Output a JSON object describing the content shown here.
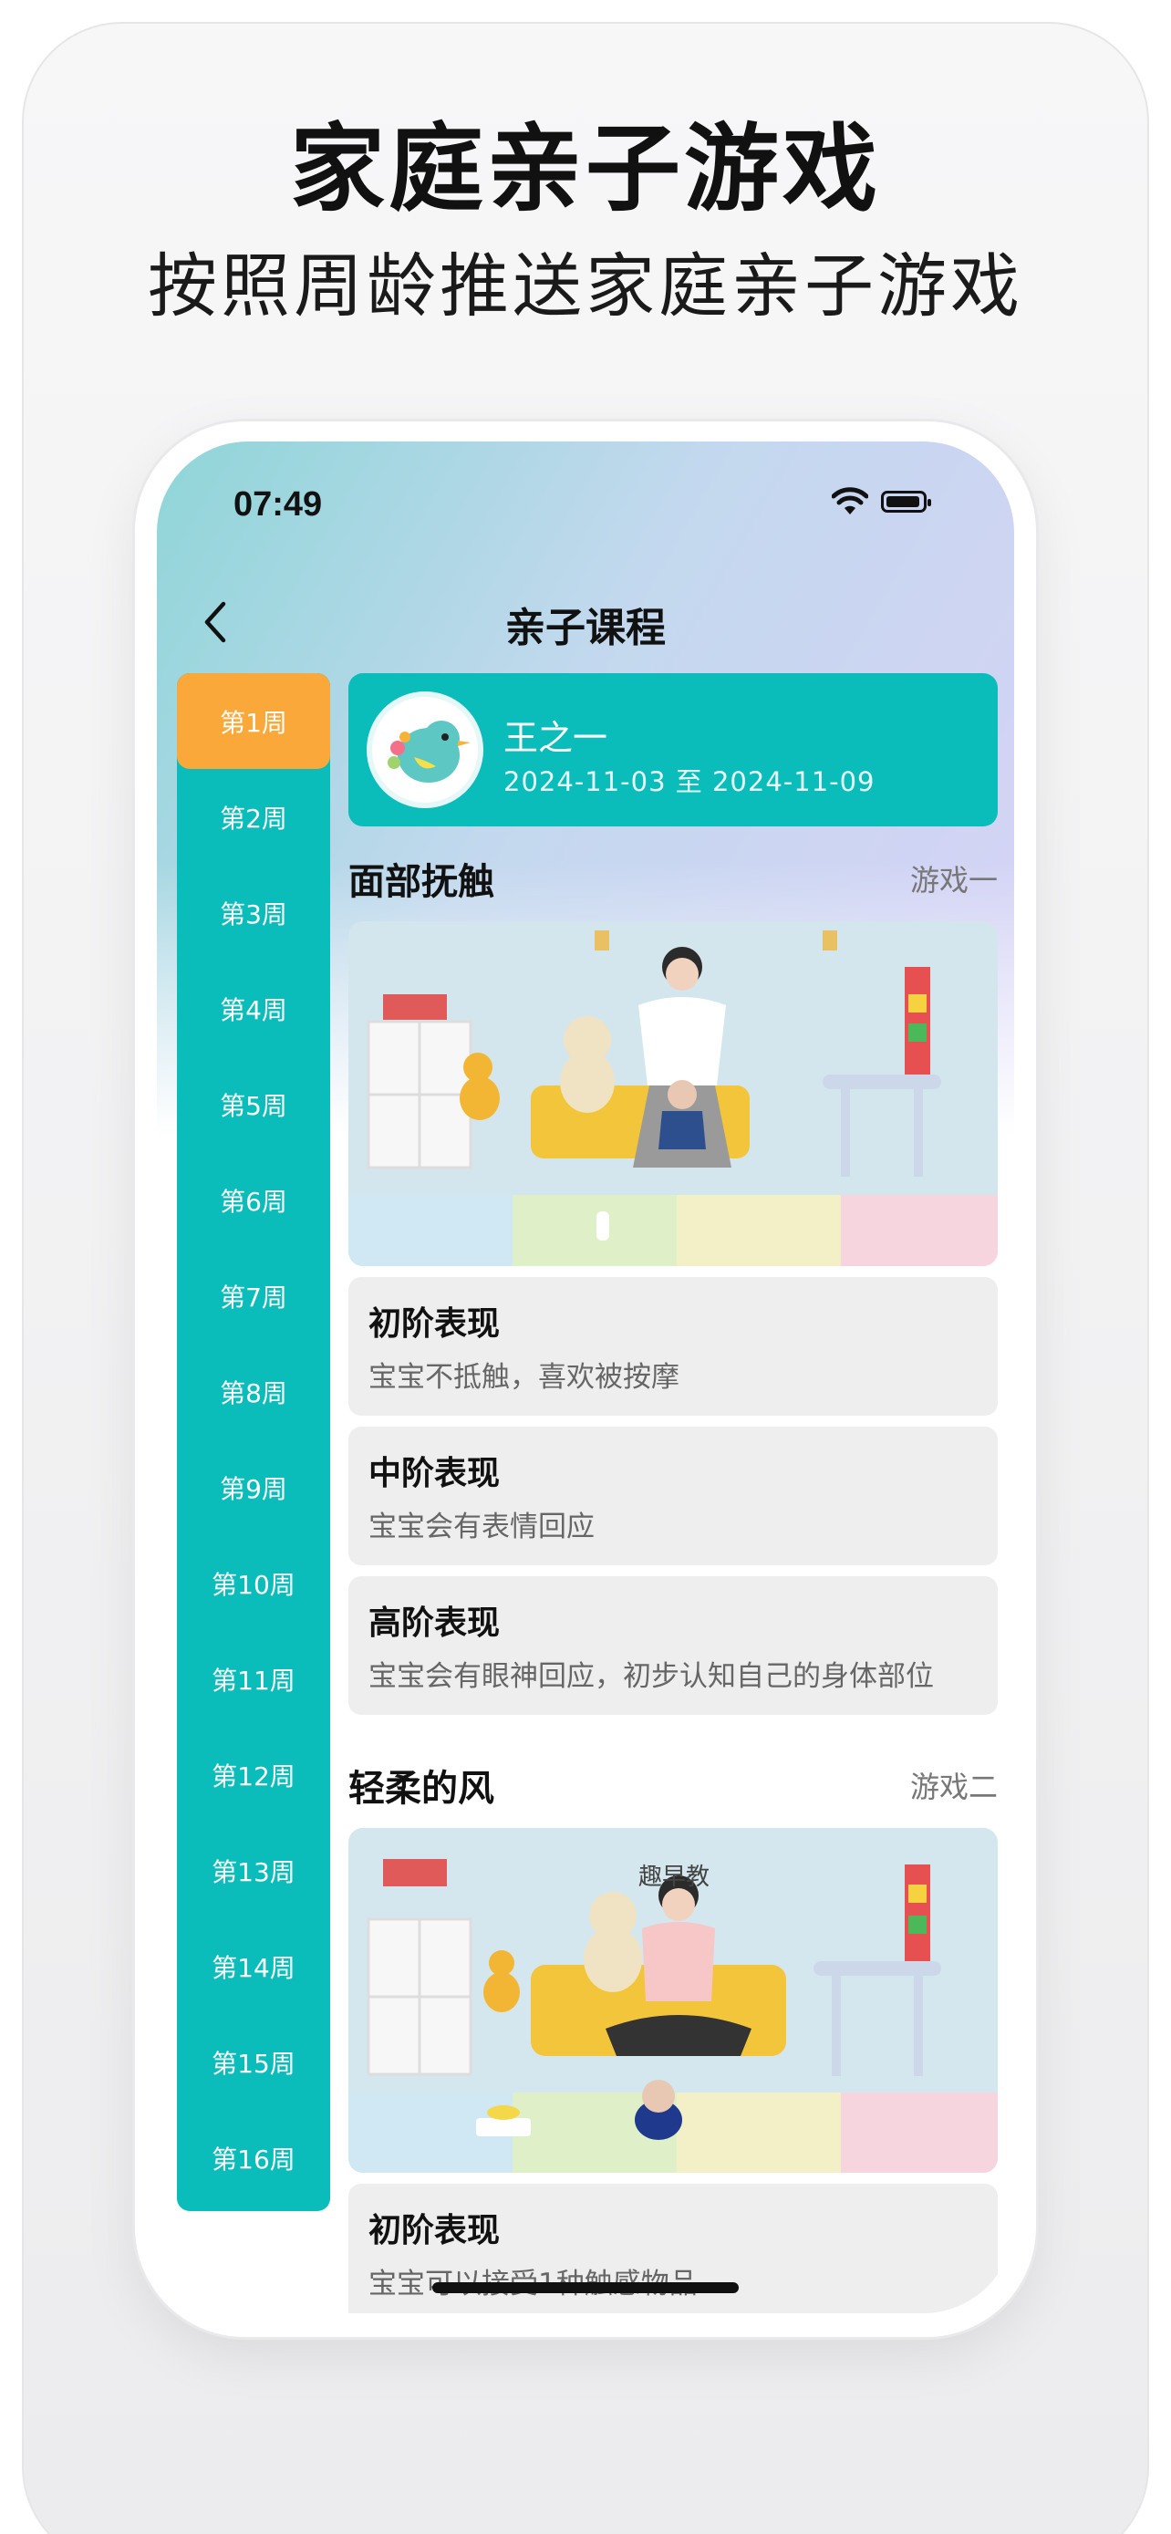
{
  "promo": {
    "headline": "家庭亲子游戏",
    "subline": "按照周龄推送家庭亲子游戏"
  },
  "status_bar": {
    "time": "07:49",
    "wifi_icon": "wifi-icon",
    "battery_icon": "battery-icon"
  },
  "nav": {
    "back_icon": "chevron-left-icon",
    "title": "亲子课程"
  },
  "weeks": {
    "active_index": 0,
    "items": [
      "第1周",
      "第2周",
      "第3周",
      "第4周",
      "第5周",
      "第6周",
      "第7周",
      "第8周",
      "第9周",
      "第10周",
      "第11周",
      "第12周",
      "第13周",
      "第14周",
      "第15周",
      "第16周"
    ]
  },
  "profile": {
    "name": "王之一",
    "date_range": "2024-11-03 至 2024-11-09",
    "avatar_icon": "bird-avatar-icon"
  },
  "games": [
    {
      "title": "面部抚触",
      "tag": "游戏一",
      "stages": [
        {
          "title": "初阶表现",
          "desc": "宝宝不抵触，喜欢被按摩"
        },
        {
          "title": "中阶表现",
          "desc": "宝宝会有表情回应"
        },
        {
          "title": "高阶表现",
          "desc": "宝宝会有眼神回应，初步认知自己的身体部位"
        }
      ]
    },
    {
      "title": "轻柔的风",
      "tag": "游戏二",
      "video_sign": "趣早教",
      "stages": [
        {
          "title": "初阶表现",
          "desc": "宝宝可以接受1种触感物品"
        }
      ]
    }
  ],
  "colors": {
    "teal": "#0bbdba",
    "orange": "#fba83a",
    "stage_bg": "#eeeeee"
  }
}
